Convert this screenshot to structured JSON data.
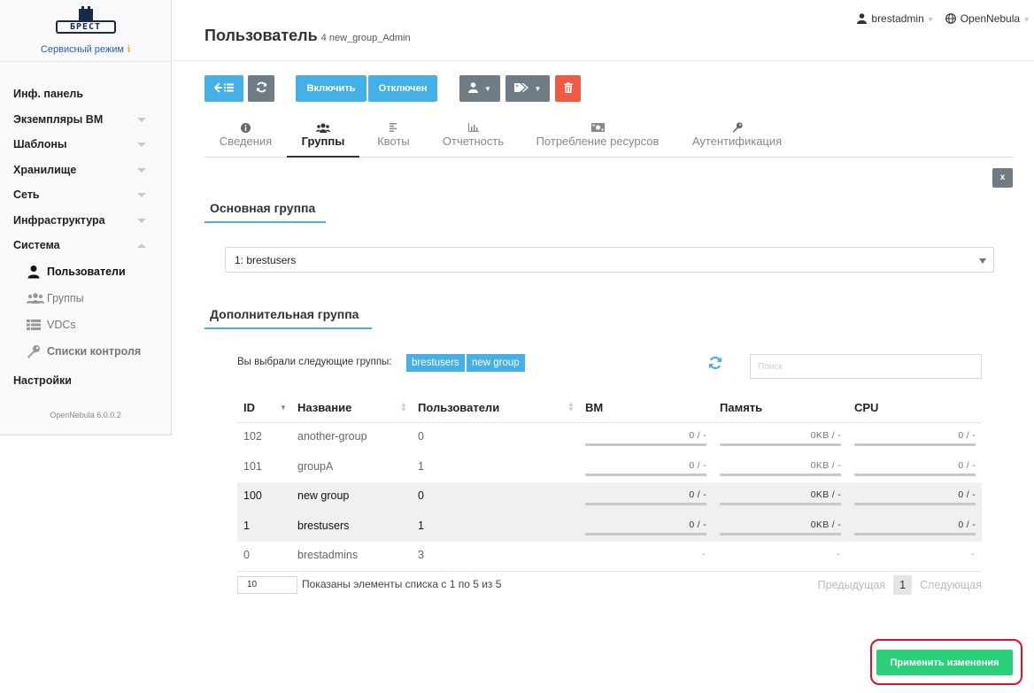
{
  "brand": {
    "logo_text": "БРЕСТ",
    "mode": "Сервисный режим",
    "mode_info": "i"
  },
  "sidebar": {
    "items": [
      {
        "label": "Инф. панель",
        "chevron": "none"
      },
      {
        "label": "Экземпляры ВМ",
        "chevron": "down"
      },
      {
        "label": "Шаблоны",
        "chevron": "down"
      },
      {
        "label": "Хранилище",
        "chevron": "down"
      },
      {
        "label": "Сеть",
        "chevron": "down"
      },
      {
        "label": "Инфраструктура",
        "chevron": "down"
      },
      {
        "label": "Система",
        "chevron": "up"
      }
    ],
    "sub_items": [
      {
        "label": "Пользователи",
        "icon": "user-icon",
        "active": true
      },
      {
        "label": "Группы",
        "icon": "users-icon",
        "active": false
      },
      {
        "label": "VDCs",
        "icon": "list-icon",
        "active": false
      },
      {
        "label": "Списки контроля",
        "icon": "key-icon",
        "active": false
      }
    ],
    "settings": "Настройки",
    "version": "OpenNebula 6.0.0.2"
  },
  "header": {
    "title": "Пользователь",
    "subtitle": "4 new_group_Admin",
    "user": "brestadmin",
    "zone": "OpenNebula"
  },
  "toolbar": {
    "back_icon": "back-list-icon",
    "refresh_icon": "refresh-icon",
    "enable_label": "Включить",
    "disable_label": "Отключен",
    "user_menu_icon": "user-icon",
    "tags_menu_icon": "tags-icon",
    "delete_icon": "trash-icon"
  },
  "tabs": [
    {
      "label": "Сведения",
      "icon": "info-icon",
      "active": false
    },
    {
      "label": "Группы",
      "icon": "users-icon",
      "active": true
    },
    {
      "label": "Квоты",
      "icon": "align-left-icon",
      "active": false
    },
    {
      "label": "Отчетность",
      "icon": "bar-chart-icon",
      "active": false
    },
    {
      "label": "Потребление ресурсов",
      "icon": "money-icon",
      "active": false
    },
    {
      "label": "Аутентификация",
      "icon": "key-icon",
      "active": false
    }
  ],
  "close_label": "x",
  "primary_group": {
    "title": "Основная группа",
    "selected": "1: brestusers"
  },
  "secondary_group": {
    "title": "Дополнительная группа",
    "chosen_label": "Вы выбрали следующие группы:",
    "chosen_tags": [
      "brestusers",
      "new group"
    ],
    "search_placeholder": "Поиск"
  },
  "table": {
    "columns": [
      "ID",
      "Название",
      "Пользователи",
      "ВМ",
      "Память",
      "CPU"
    ],
    "rows": [
      {
        "id": "102",
        "name": "another-group",
        "users": "0",
        "vm": "0 / -",
        "mem": "0KB / -",
        "cpu": "0 / -",
        "selected": false,
        "bars": true
      },
      {
        "id": "101",
        "name": "groupA",
        "users": "1",
        "vm": "0 / -",
        "mem": "0KB / -",
        "cpu": "0 / -",
        "selected": false,
        "bars": true
      },
      {
        "id": "100",
        "name": "new group",
        "users": "0",
        "vm": "0 / -",
        "mem": "0KB / -",
        "cpu": "0 / -",
        "selected": true,
        "bars": true
      },
      {
        "id": "1",
        "name": "brestusers",
        "users": "1",
        "vm": "0 / -",
        "mem": "0KB / -",
        "cpu": "0 / -",
        "selected": true,
        "bars": true
      },
      {
        "id": "0",
        "name": "brestadmins",
        "users": "3",
        "vm": "-",
        "mem": "-",
        "cpu": "-",
        "selected": false,
        "bars": false
      }
    ]
  },
  "pagination": {
    "page_size": "10",
    "shown_text": "Показаны элементы списка с 1 по 5 из 5",
    "prev": "Предыдущая",
    "page": "1",
    "next": "Следующая"
  },
  "apply_label": "Применить изменения",
  "colors": {
    "accent": "#45b0e5",
    "apply": "#2bd07a",
    "delete": "#ef5a42",
    "highlight": "#e0141e"
  }
}
